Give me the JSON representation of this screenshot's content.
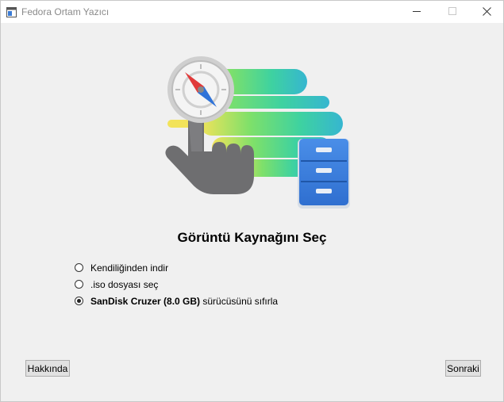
{
  "window": {
    "title": "Fedora Ortam Yazıcı",
    "icon": "app-window-icon"
  },
  "colors": {
    "accent_blue": "#3a7bd5",
    "gradient_green": "#50e08a",
    "gradient_cyan": "#38b8c8",
    "gradient_yellow": "#f0e060",
    "hand_gray": "#6b6b6b"
  },
  "main": {
    "heading": "Görüntü Kaynağını Seç",
    "options": [
      {
        "label_bold": "",
        "label": "Kendiliğinden indir",
        "selected": false
      },
      {
        "label_bold": "",
        "label": ".iso dosyası seç",
        "selected": false
      },
      {
        "label_bold": "SanDisk Cruzer (8.0 GB)",
        "label": " sürücüsünü sıfırla",
        "selected": true
      }
    ]
  },
  "buttons": {
    "about": "Hakkında",
    "next": "Sonraki"
  }
}
